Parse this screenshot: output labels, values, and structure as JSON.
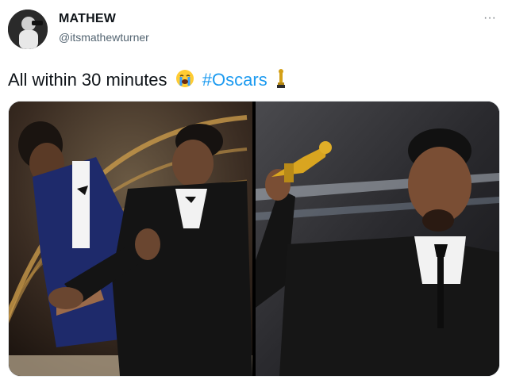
{
  "tweet": {
    "display_name": "MATHEW",
    "handle": "@itsmathewturner",
    "more_label": "···",
    "text": "All within 30 minutes",
    "emoji_crying": "crying-face-emoji",
    "hashtag": "#Oscars",
    "emoji_trophy": "oscar-trophy-emoji"
  },
  "colors": {
    "hashtag": "#1d9bf0",
    "handle": "#536471",
    "text": "#0f1419"
  }
}
